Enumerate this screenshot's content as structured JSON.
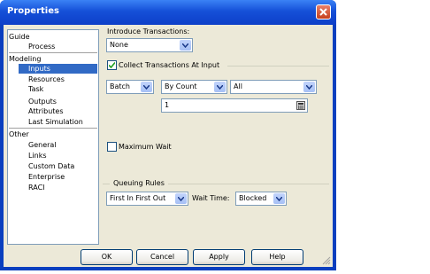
{
  "window": {
    "title": "Properties"
  },
  "tree": {
    "groups": [
      {
        "label": "Guide",
        "items": [
          "Process"
        ]
      },
      {
        "label": "Modeling",
        "items": [
          "Inputs",
          "Resources",
          "Task",
          "Outputs",
          "Attributes",
          "Last Simulation"
        ]
      },
      {
        "label": "Other",
        "items": [
          "General",
          "Links",
          "Custom Data",
          "Enterprise",
          "RACI"
        ]
      }
    ],
    "selected": "Inputs"
  },
  "inputs": {
    "introduce_label": "Introduce Transactions:",
    "introduce_value": "None",
    "collect_label": "Collect Transactions At Input",
    "collect_checked": true,
    "batch_value": "Batch",
    "by_value": "By Count",
    "all_value": "All",
    "count_value": "1",
    "max_wait_label": "Maximum Wait",
    "max_wait_checked": false,
    "queuing_title": "Queuing Rules",
    "queue_rule_value": "First In First Out",
    "wait_time_label": "Wait Time:",
    "wait_time_value": "Blocked"
  },
  "buttons": {
    "ok": "OK",
    "cancel": "Cancel",
    "apply": "Apply",
    "help": "Help"
  },
  "colors": {
    "titlebar": "#0d3fc8",
    "selection": "#316ac5",
    "face": "#ece9d8"
  }
}
